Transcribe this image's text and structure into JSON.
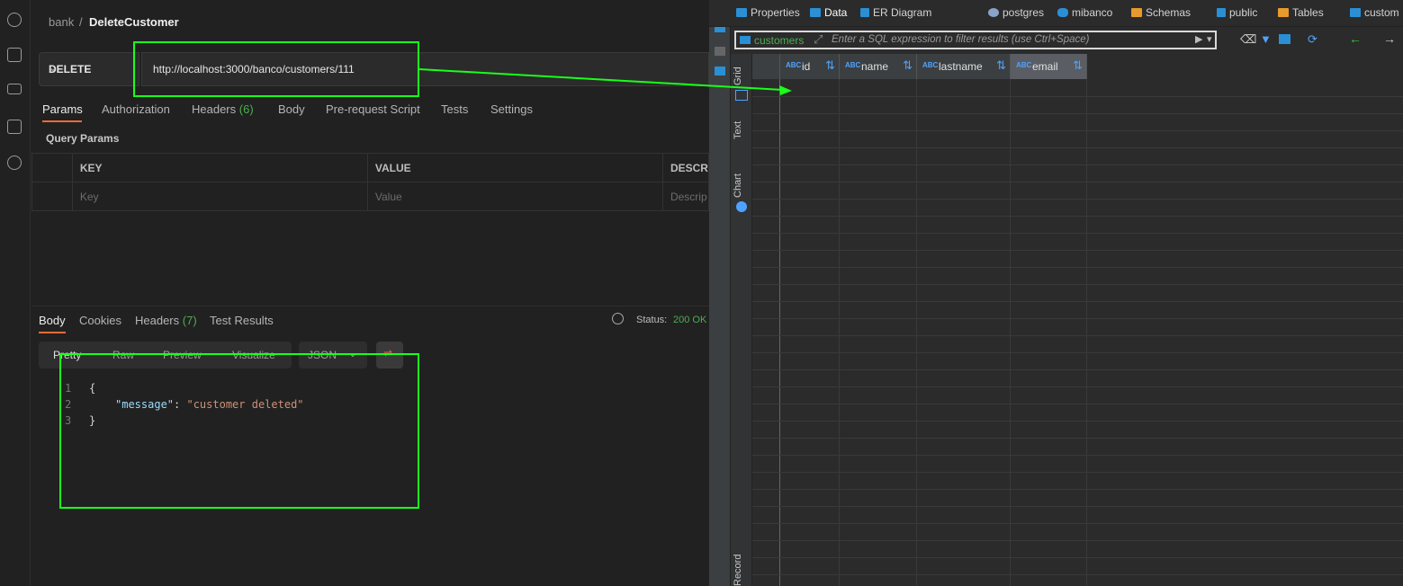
{
  "postman": {
    "breadcrumb": {
      "collection": "bank",
      "sep": "/",
      "request": "DeleteCustomer"
    },
    "method": "DELETE",
    "url": "http://localhost:3000/banco/customers/111",
    "request_tabs": [
      "Params",
      "Authorization",
      "Headers",
      "(6)",
      "Body",
      "Pre-request Script",
      "Tests",
      "Settings"
    ],
    "query_params_title": "Query Params",
    "params_table": {
      "headers": [
        "KEY",
        "VALUE",
        "DESCR"
      ],
      "placeholders": [
        "Key",
        "Value",
        "Descrip"
      ]
    },
    "response_tabs": [
      "Body",
      "Cookies",
      "Headers",
      "(7)",
      "Test Results"
    ],
    "status_label": "Status:",
    "status_value": "200 OK",
    "view_modes": [
      "Pretty",
      "Raw",
      "Preview",
      "Visualize"
    ],
    "format": "JSON",
    "code_lines": [
      {
        "n": "1",
        "text": "{"
      },
      {
        "n": "2",
        "key": "\"message\"",
        "colon": ": ",
        "value": "\"customer deleted\""
      },
      {
        "n": "3",
        "text": "}"
      }
    ]
  },
  "dbeaver": {
    "toolbar_tabs": [
      "Properties",
      "Data",
      "ER Diagram",
      "postgres",
      "mibanco",
      "Schemas",
      "public",
      "Tables",
      "custom"
    ],
    "filter_table": "customers",
    "filter_placeholder": "Enter a SQL expression to filter results (use Ctrl+Space)",
    "side_tabs": [
      "Grid",
      "Text",
      "Chart",
      "Record"
    ],
    "columns": [
      "id",
      "name",
      "lastname",
      "email"
    ],
    "type_label": "ABC"
  },
  "colors": {
    "accent": "#f06b36",
    "status_ok": "#4caf50",
    "highlight": "#1aff1a",
    "db_blue": "#4fa3ff"
  }
}
